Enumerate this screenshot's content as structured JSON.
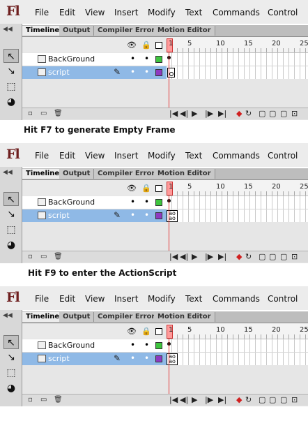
{
  "app": {
    "logo": "Fl",
    "menu": [
      "File",
      "Edit",
      "View",
      "Insert",
      "Modify",
      "Text",
      "Commands",
      "Control"
    ]
  },
  "panel": {
    "tabs": [
      "Timeline",
      "Output",
      "Compiler Errors",
      "Motion Editor"
    ],
    "active_tab": "Timeline",
    "ruler_labels": [
      "1",
      "5",
      "10",
      "15",
      "20",
      "25"
    ],
    "layers": [
      {
        "name": "BackGround",
        "selected": false,
        "color": "#3ec43e"
      },
      {
        "name": "script",
        "selected": true,
        "color": "#8e3ac0"
      }
    ],
    "icons": {
      "eye": "👁",
      "lock": "🔒",
      "pencil": "✎",
      "dot": "•",
      "panel_grip": "◀◀",
      "new_layer": "▫",
      "new_folder": "▭",
      "delete": "🗑",
      "tools": [
        "↖",
        "↘",
        "⬚",
        "◕"
      ],
      "controls": [
        "|◀",
        "◀|",
        "▶",
        "|▶",
        "▶|",
        "◆",
        "↻",
        "▢",
        "▢",
        "▢",
        "⊡"
      ]
    },
    "colors": {
      "selected_row": "#8fb9e6",
      "playhead": "#e23a3a"
    }
  },
  "captions": [
    "Hit F7 to generate Empty Frame",
    "Hit F9 to enter the ActionScript"
  ]
}
